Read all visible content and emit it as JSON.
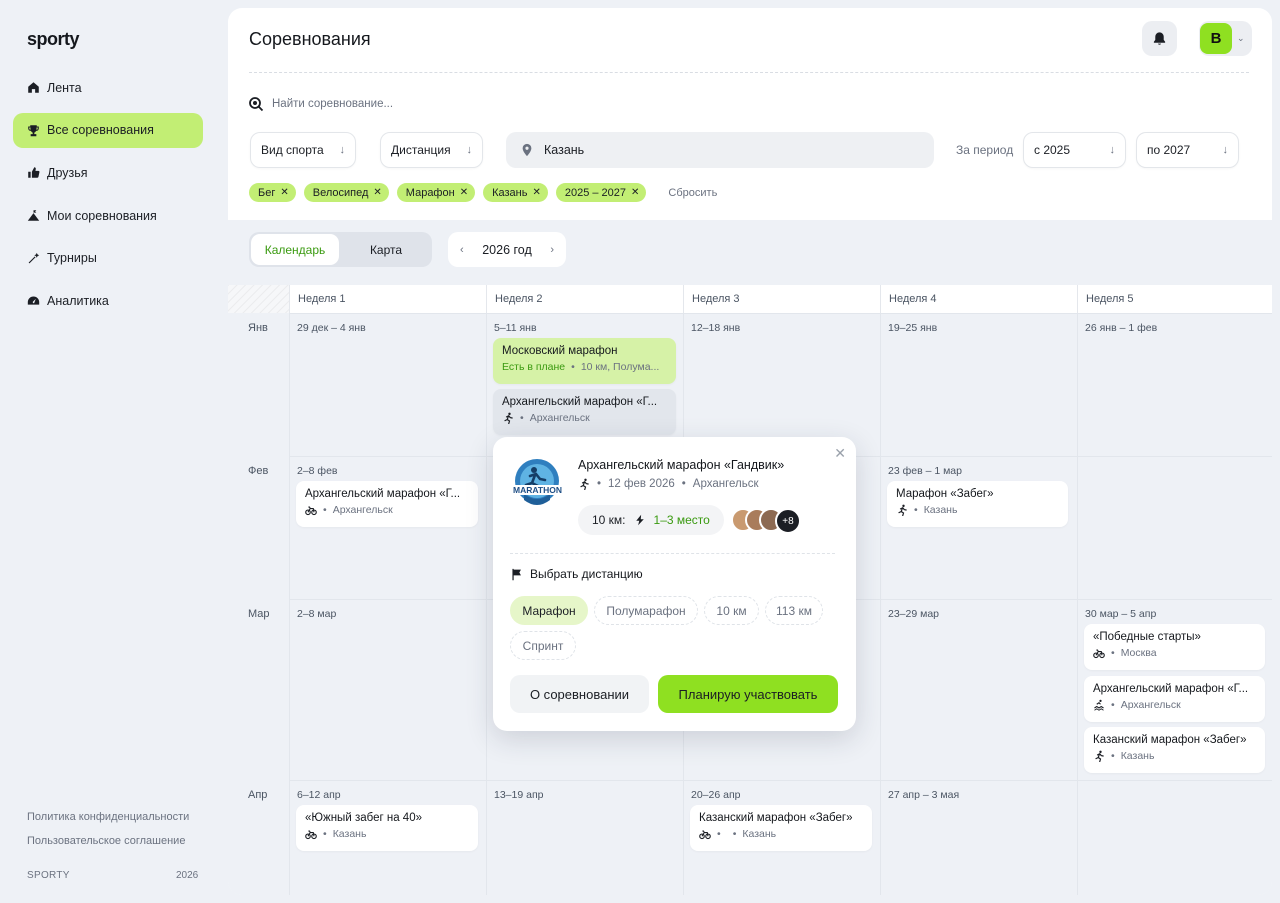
{
  "app": {
    "logo": "sporty"
  },
  "sidebar": {
    "items": [
      {
        "label": "Лента",
        "icon": "home-icon"
      },
      {
        "label": "Все соревнования",
        "icon": "trophy-icon",
        "active": true
      },
      {
        "label": "Друзья",
        "icon": "thumbs-up-icon"
      },
      {
        "label": "Мои соревнования",
        "icon": "mountain-flag-icon"
      },
      {
        "label": "Турниры",
        "icon": "wand-icon"
      },
      {
        "label": "Аналитика",
        "icon": "gauge-icon"
      }
    ],
    "footer": {
      "privacy": "Политика конфиденциальности",
      "terms": "Пользовательское соглашение",
      "brand": "SPORTY",
      "year": "2026"
    }
  },
  "header": {
    "title": "Соревнования",
    "avatar_letter": "В"
  },
  "search": {
    "placeholder": "Найти соревнование..."
  },
  "filters": {
    "sport": "Вид спорта",
    "distance": "Дистанция",
    "city": "Казань",
    "period_label": "За период",
    "from": "с 2025",
    "to": "по 2027",
    "chips": [
      "Бег",
      "Велосипед",
      "Марафон",
      "Казань",
      "2025 – 2027"
    ],
    "reset": "Сбросить"
  },
  "view": {
    "calendar": "Календарь",
    "map": "Карта",
    "year": "2026 год"
  },
  "calendar": {
    "weeks": [
      "Неделя 1",
      "Неделя 2",
      "Неделя 3",
      "Неделя 4",
      "Неделя 5"
    ],
    "months": [
      {
        "name": "Янв",
        "dates": [
          "29 дек – 4 янв",
          "5–11 янв",
          "12–18 янв",
          "19–25 янв",
          "26 янв – 1 фев"
        ]
      },
      {
        "name": "Фев",
        "dates": [
          "2–8 фев",
          "",
          "",
          "23 фев – 1 мар",
          ""
        ]
      },
      {
        "name": "Мар",
        "dates": [
          "2–8 мар",
          "",
          "",
          "23–29 мар",
          "30 мар – 5 апр"
        ]
      },
      {
        "name": "Апр",
        "dates": [
          "6–12 апр",
          "13–19 апр",
          "20–26 апр",
          "27 апр – 3 мая",
          ""
        ]
      }
    ],
    "events": {
      "jan_w2_a": {
        "title": "Московский марафон",
        "status": "Есть в плане",
        "info": "10 км, Полума..."
      },
      "jan_w2_b": {
        "title": "Архангельский марафон «Г...",
        "city": "Архангельск",
        "sport": "run-icon"
      },
      "feb_w1": {
        "title": "Архангельский марафон «Г...",
        "city": "Архангельск",
        "sport": "bike-icon"
      },
      "feb_w4": {
        "title": "Марафон «Забег»",
        "city": "Казань",
        "sport": "run-icon"
      },
      "mar_w5_a": {
        "title": "«Победные старты»",
        "city": "Москва",
        "sport": "bike-icon"
      },
      "mar_w5_b": {
        "title": "Архангельский марафон «Г...",
        "city": "Архангельск",
        "sport": "triathlon-icon"
      },
      "mar_w5_c": {
        "title": "Казанский марафон «Забег»",
        "city": "Казань",
        "sport": "run-icon"
      },
      "apr_w1": {
        "title": "«Южный забег на 40»",
        "city": "Казань",
        "sport": "bike-icon"
      },
      "apr_w3": {
        "title": "Казанский марафон «Забег»",
        "city": "Казань",
        "sport": "bike-icon"
      }
    }
  },
  "popup": {
    "title": "Архангельский марафон «Гандвик»",
    "date": "12 фев 2026",
    "city": "Архангельск",
    "result_distance": "10 км:",
    "result_place": "1–3 место",
    "friends_more": "+8",
    "choose_distance": "Выбрать дистанцию",
    "distances": [
      "Марафон",
      "Полумарафон",
      "10 км",
      "113 км",
      "Спринт"
    ],
    "about_button": "О соревновании",
    "plan_button": "Планирую участвовать",
    "logo_text": "MARATHON"
  },
  "colors": {
    "accent": "#8fe021",
    "accent_soft": "#c2ee74",
    "bg": "#eef1f6"
  }
}
